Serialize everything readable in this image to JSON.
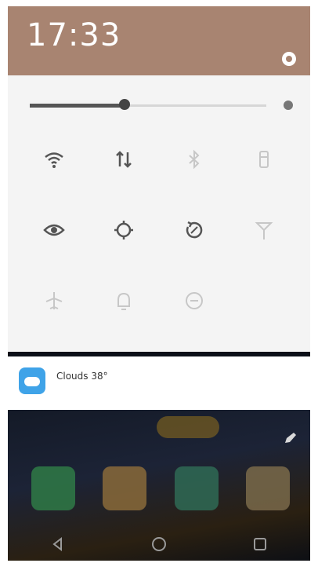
{
  "header": {
    "time": "17:33",
    "date": "",
    "settings_icon": "gear-icon"
  },
  "brightness": {
    "level": 0.4,
    "icon": "sun-icon"
  },
  "quick_settings": [
    {
      "label": "",
      "icon": "wifi-icon",
      "state": "on"
    },
    {
      "label": "",
      "icon": "mobile-data-icon",
      "state": "on"
    },
    {
      "label": "",
      "icon": "bluetooth-icon",
      "state": "off"
    },
    {
      "label": "",
      "icon": "flashlight-icon",
      "state": "off"
    },
    {
      "label": "",
      "icon": "eye-comfort-icon",
      "state": "on"
    },
    {
      "label": "",
      "icon": "location-icon",
      "state": "on"
    },
    {
      "label": "",
      "icon": "auto-rotate-icon",
      "state": "on"
    },
    {
      "label": "",
      "icon": "hotspot-icon",
      "state": "off"
    },
    {
      "label": "",
      "icon": "airplane-icon",
      "state": "off"
    },
    {
      "label": "",
      "icon": "silent-icon",
      "state": "off"
    },
    {
      "label": "",
      "icon": "do-not-disturb-icon",
      "state": "off"
    }
  ],
  "notification": {
    "app_icon": "weather-app-icon",
    "title": "Clouds 38°",
    "right_line": "",
    "sub_line": ""
  },
  "home": {
    "dock": [
      {
        "icon": "phone-app-icon"
      },
      {
        "icon": "contacts-app-icon"
      },
      {
        "icon": "messages-app-icon"
      },
      {
        "icon": "browser-app-icon"
      }
    ],
    "nav": [
      {
        "icon": "back-icon"
      },
      {
        "icon": "home-icon"
      },
      {
        "icon": "recents-icon"
      }
    ]
  },
  "colors": {
    "header_bg": "#a88471",
    "panel_bg": "#f4f4f4",
    "weather_icon": "#3fa3e8"
  }
}
